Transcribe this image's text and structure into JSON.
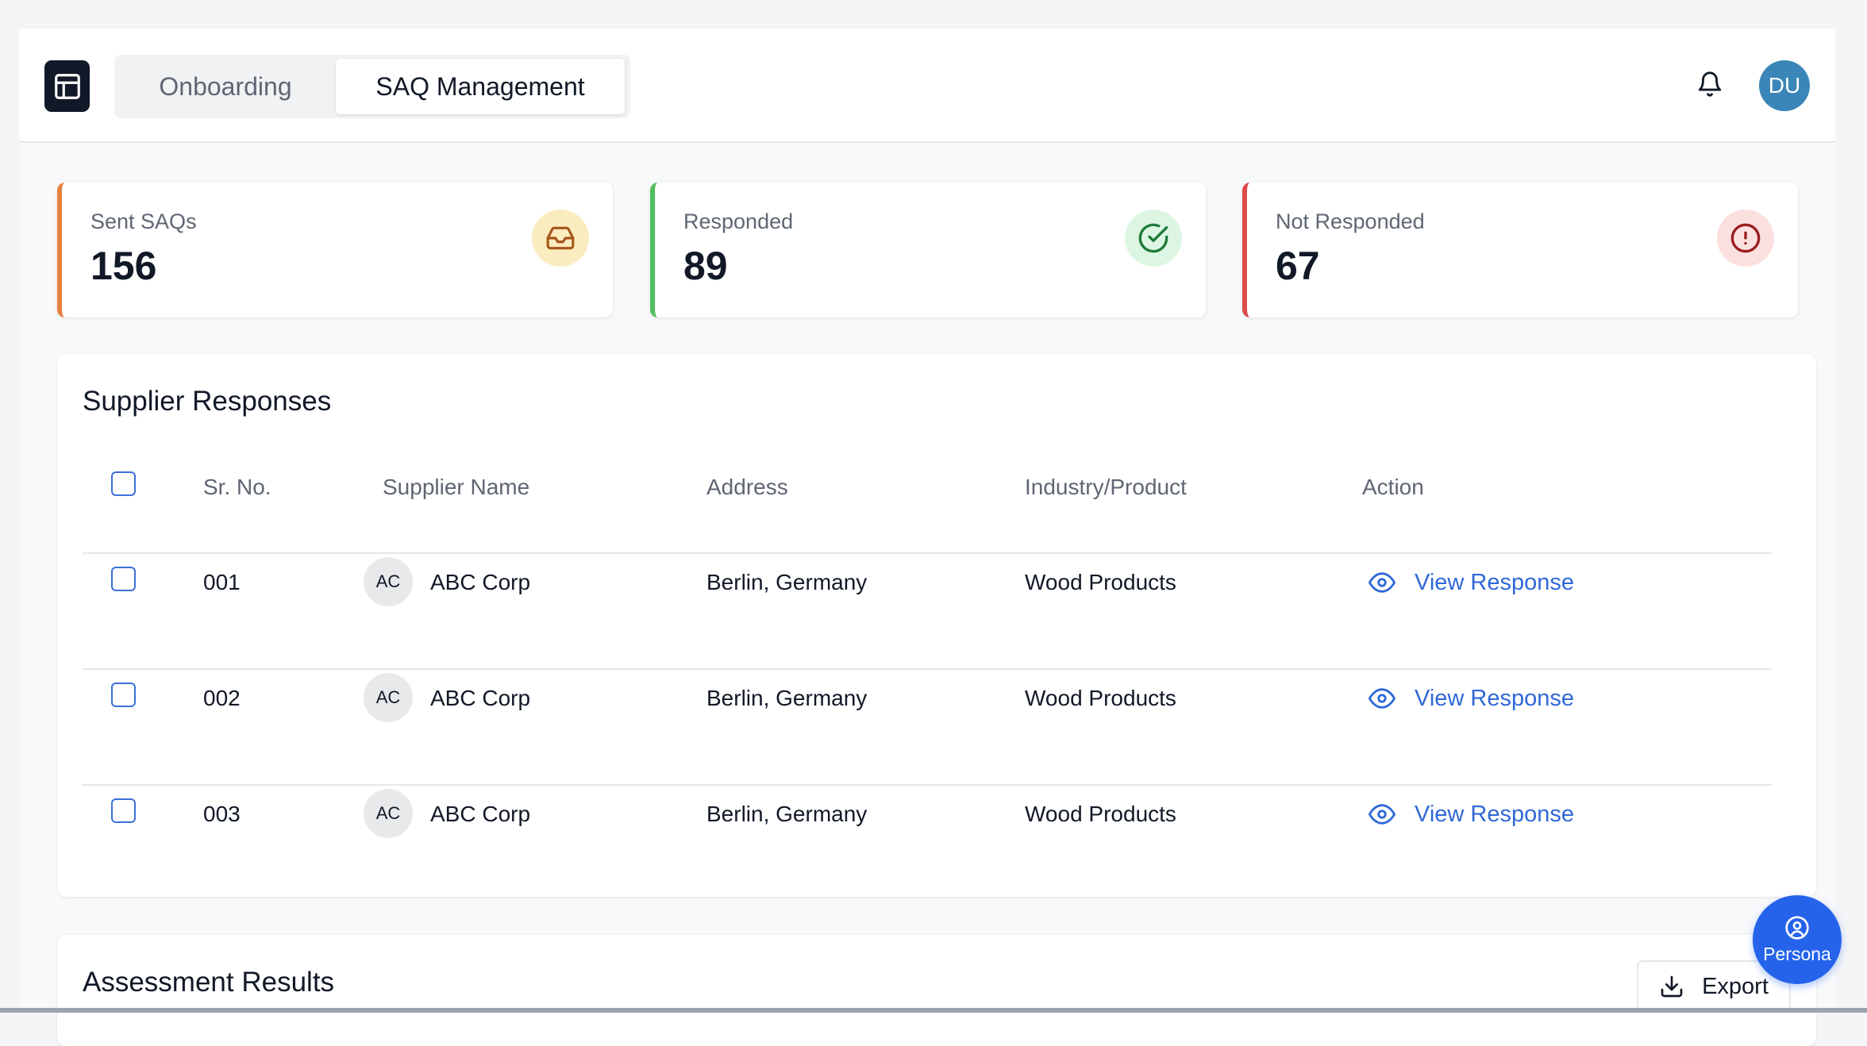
{
  "header": {
    "tabs": [
      {
        "label": "Onboarding",
        "active": false
      },
      {
        "label": "SAQ Management",
        "active": true
      }
    ],
    "user_initials": "DU"
  },
  "stats": [
    {
      "label": "Sent SAQs",
      "value": "156",
      "icon": "inbox-icon",
      "accent": "#e8803c"
    },
    {
      "label": "Responded",
      "value": "89",
      "icon": "check-circle-icon",
      "accent": "#4fbf5b"
    },
    {
      "label": "Not Responded",
      "value": "67",
      "icon": "alert-circle-icon",
      "accent": "#dc4a4a"
    }
  ],
  "supplier_responses": {
    "title": "Supplier Responses",
    "columns": [
      "Sr. No.",
      "Supplier Name",
      "Address",
      "Industry/Product",
      "Action"
    ],
    "rows": [
      {
        "sr": "001",
        "initials": "AC",
        "name": "ABC Corp",
        "address": "Berlin, Germany",
        "industry": "Wood Products",
        "action": "View Response"
      },
      {
        "sr": "002",
        "initials": "AC",
        "name": "ABC Corp",
        "address": "Berlin, Germany",
        "industry": "Wood Products",
        "action": "View Response"
      },
      {
        "sr": "003",
        "initials": "AC",
        "name": "ABC Corp",
        "address": "Berlin, Germany",
        "industry": "Wood Products",
        "action": "View Response"
      }
    ]
  },
  "assessment_results": {
    "title": "Assessment Results",
    "export_label": "Export"
  },
  "persona_label": "Persona"
}
